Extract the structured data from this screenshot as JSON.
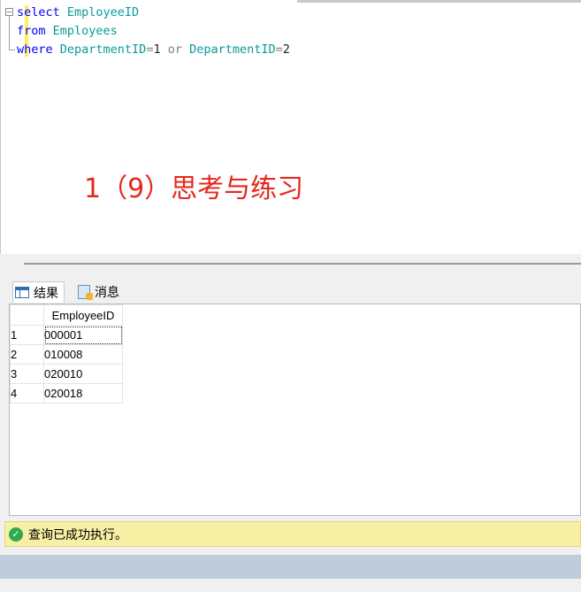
{
  "editor": {
    "code_lines": [
      {
        "keyword": "select",
        "rest": " EmployeeID"
      },
      {
        "keyword": "from",
        "rest": " Employees"
      },
      {
        "keyword": "where",
        "part1": " DepartmentID",
        "op1": "=",
        "num1": "1",
        "or": " or ",
        "part2": "DepartmentID",
        "op2": "=",
        "num2": "2"
      }
    ],
    "fold_symbol": "−"
  },
  "annotation": {
    "text": "1（9）思考与练习",
    "color": "#e8261b"
  },
  "tabs": {
    "results_label": "结果",
    "messages_label": "消息"
  },
  "results": {
    "columns": [
      "EmployeeID"
    ],
    "rows": [
      {
        "rownum": "1",
        "EmployeeID": "000001"
      },
      {
        "rownum": "2",
        "EmployeeID": "010008"
      },
      {
        "rownum": "3",
        "EmployeeID": "020010"
      },
      {
        "rownum": "4",
        "EmployeeID": "020018"
      }
    ]
  },
  "status": {
    "text": "查询已成功执行。",
    "icon": "success-check-icon",
    "color": "#f7f0a4"
  }
}
